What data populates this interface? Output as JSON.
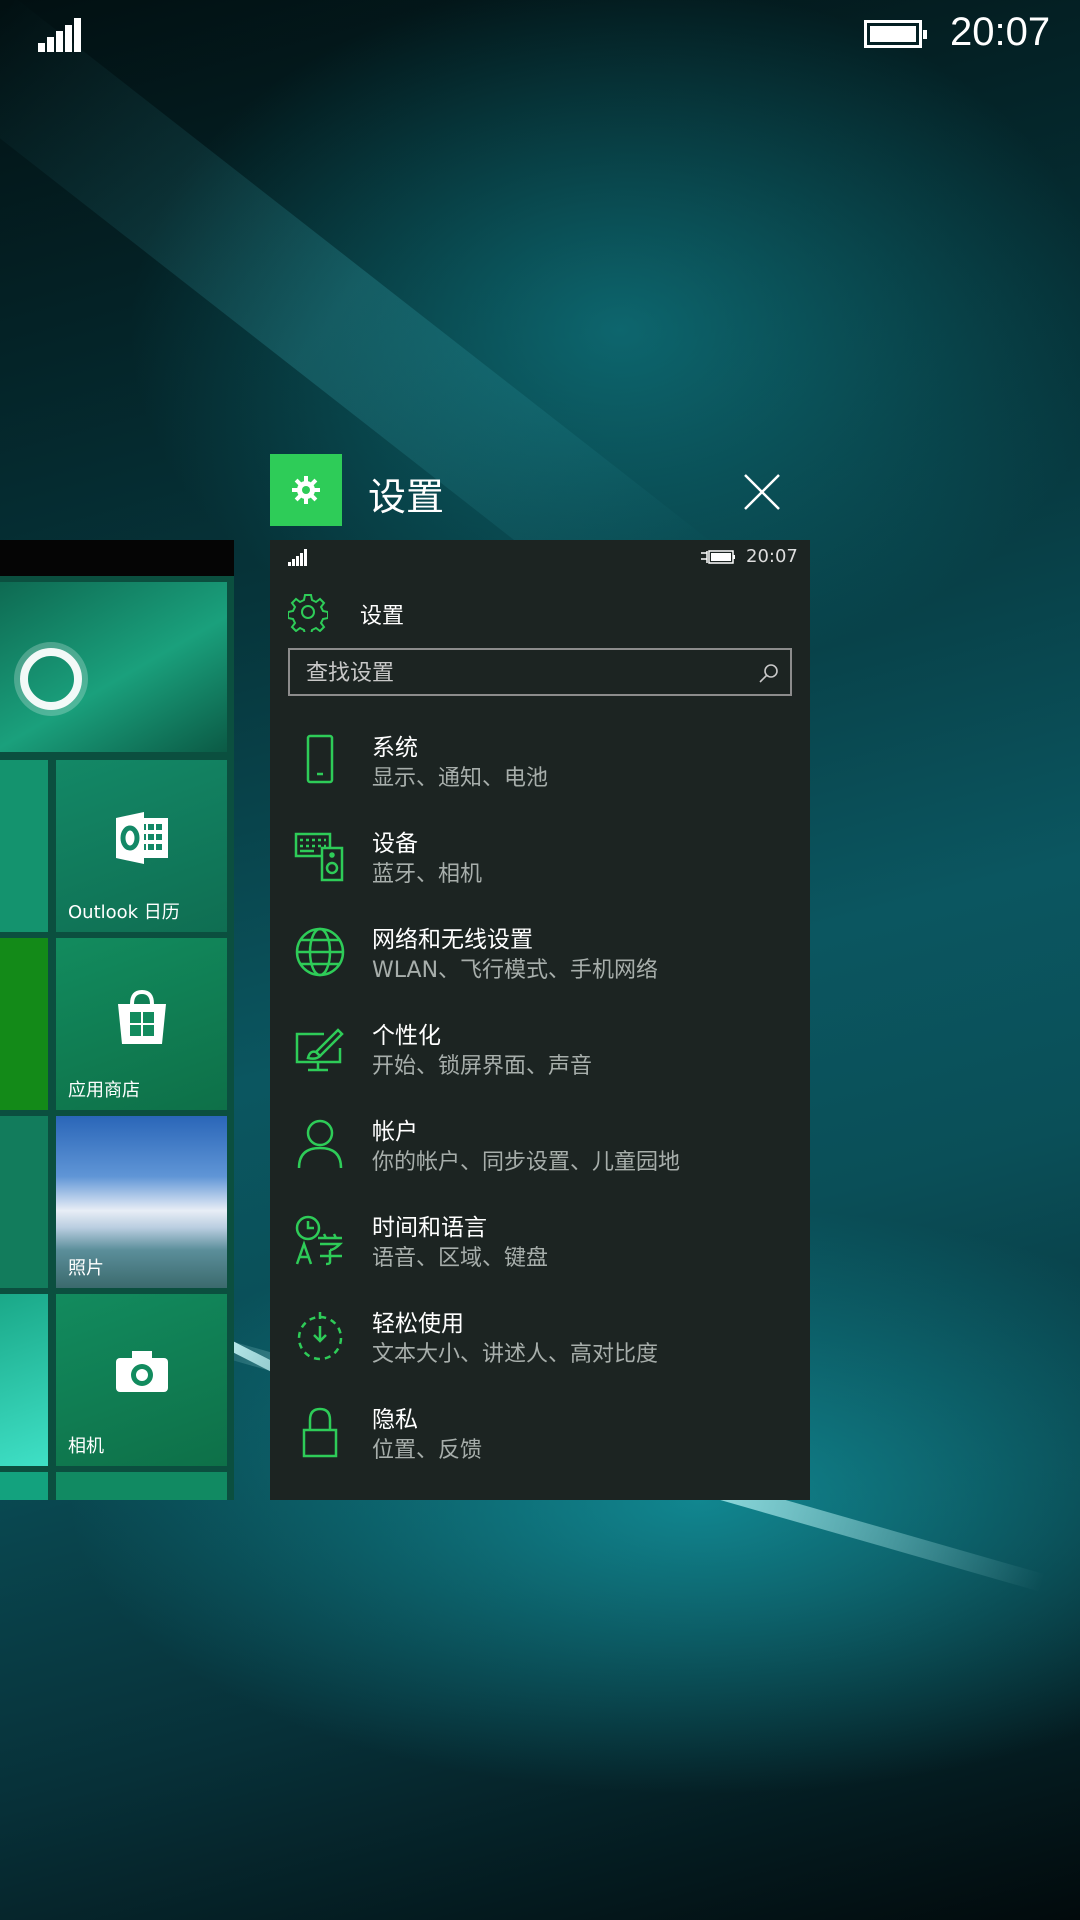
{
  "status_bar": {
    "time": "20:07"
  },
  "task_card": {
    "title": "设置",
    "status_time": "20:07",
    "header_title": "设置",
    "search": {
      "placeholder": "查找设置"
    },
    "items": [
      {
        "title": "系统",
        "subtitle": "显示、通知、电池",
        "icon": "phone-icon"
      },
      {
        "title": "设备",
        "subtitle": "蓝牙、相机",
        "icon": "devices-icon"
      },
      {
        "title": "网络和无线设置",
        "subtitle": "WLAN、飞行模式、手机网络",
        "icon": "globe-icon"
      },
      {
        "title": "个性化",
        "subtitle": "开始、锁屏界面、声音",
        "icon": "personalization-icon"
      },
      {
        "title": "帐户",
        "subtitle": "你的帐户、同步设置、儿童园地",
        "icon": "person-icon"
      },
      {
        "title": "时间和语言",
        "subtitle": "语音、区域、键盘",
        "icon": "time-language-icon"
      },
      {
        "title": "轻松使用",
        "subtitle": "文本大小、讲述人、高对比度",
        "icon": "ease-of-access-icon"
      },
      {
        "title": "隐私",
        "subtitle": "位置、反馈",
        "icon": "lock-icon"
      }
    ]
  },
  "start_tiles": {
    "outlook": "Outlook 日历",
    "store": "应用商店",
    "photos": "照片",
    "camera": "相机"
  },
  "colors": {
    "accent": "#2ecc58",
    "card_bg": "#1c2422"
  }
}
